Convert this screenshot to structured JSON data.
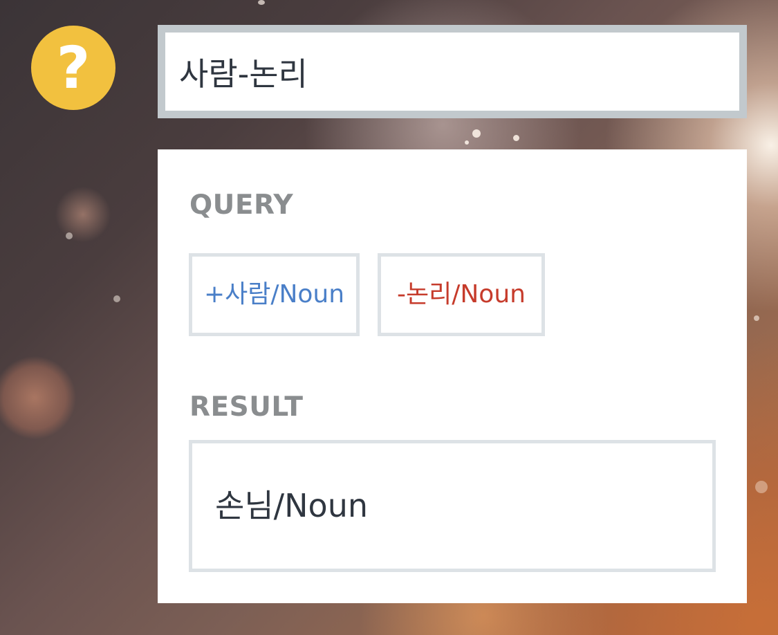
{
  "search": {
    "value": "사람-논리"
  },
  "help": {
    "icon": "question-mark-icon",
    "glyph": "?"
  },
  "query": {
    "label": "QUERY",
    "tokens": [
      {
        "text": "+사람/Noun",
        "polarity": "positive",
        "color": "#4a7fc8"
      },
      {
        "text": "-논리/Noun",
        "polarity": "negative",
        "color": "#c63b2b"
      }
    ]
  },
  "result": {
    "label": "RESULT",
    "value": "손님/Noun"
  },
  "colors": {
    "help_icon": "#f2c13f",
    "search_border": "#c2c9cd",
    "panel": "#ffffff",
    "label": "#8a8d8f",
    "text": "#2f3640",
    "token_border": "#dde2e6"
  }
}
